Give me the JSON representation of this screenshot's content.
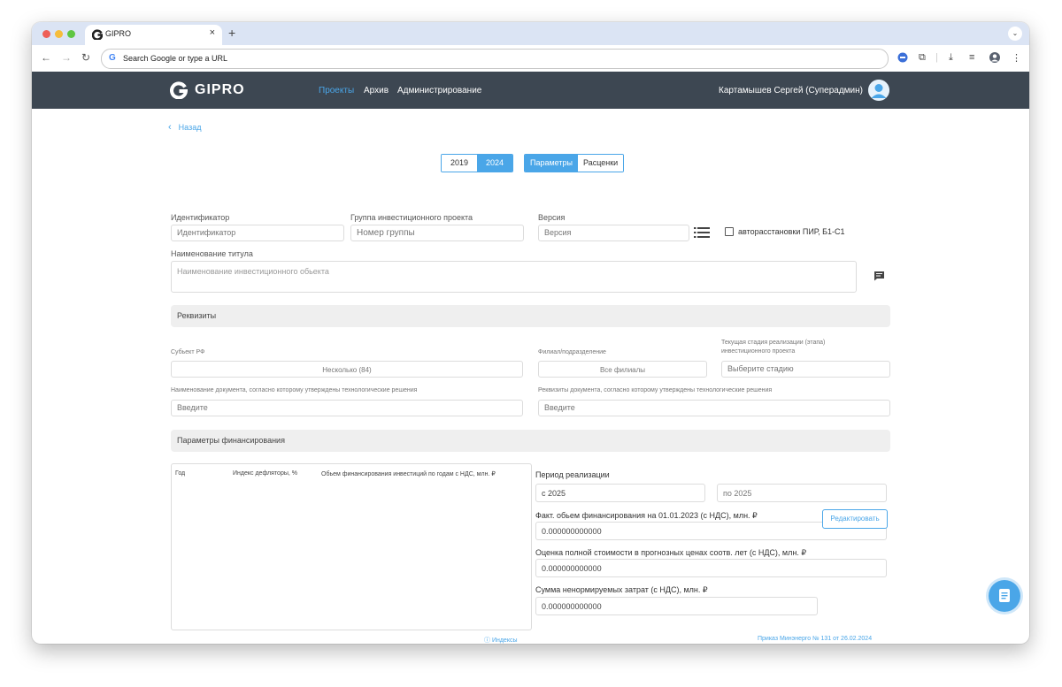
{
  "browser": {
    "tab_title": "GIPRO",
    "tab_close": "×",
    "new_tab": "+",
    "omnibox_text": "Search Google or type a URL",
    "g_letter": "G"
  },
  "app": {
    "brand": "GIPRO",
    "menu": [
      "Проекты",
      "Архив",
      "Администрирование"
    ],
    "user_name": "Картамышев Сергей (Суперадмин)"
  },
  "page": {
    "back_label": "Назад",
    "years": [
      "2019",
      "2024"
    ],
    "views": [
      "Параметры",
      "Расценки"
    ],
    "identifier": {
      "label": "Идентификатор",
      "placeholder": "Идентификатор"
    },
    "group": {
      "label": "Группа инвестиционного проекта",
      "placeholder": "Номер группы"
    },
    "version": {
      "label": "Версия",
      "placeholder": "Версия"
    },
    "auto_checkbox_label": "авторасстановки ПИР, Б1-С1",
    "title_name": {
      "label": "Наименование титула",
      "placeholder": "Наименование инвестиционного обьекта"
    },
    "section_requisites": "Реквизиты",
    "subject": {
      "label": "Субьект РФ",
      "value": "Несколько (84)"
    },
    "branch": {
      "label": "Филиал/подразделение",
      "value": "Все филиалы"
    },
    "stage": {
      "label_line1": "Текущая стадия реализации (этапа)",
      "label_line2": "инвестиционного проекта",
      "placeholder": "Выберите стадию"
    },
    "doc_name": {
      "label": "Наименование документа, согласно которому утверждены технологические решения",
      "placeholder": "Введите"
    },
    "doc_requisites": {
      "label": "Реквизиты документа, согласно которому утверждены технологические решения",
      "placeholder": "Введите"
    },
    "section_financing": "Параметры финансирования",
    "table_headers": [
      "Год",
      "Индекс дефляторы, %",
      "Обьем финансирования инвестиций по годам с НДС, млн. ₽"
    ],
    "period_label": "Период реализации",
    "period_from": "с  2025",
    "period_to": "по  2025",
    "fact_label": "Факт. обьем финансирования на 01.01.2023 (с НДС), млн. ₽",
    "fact_value": "0.000000000000",
    "estimate_label": "Оценка полной стоимости в прогнозных ценах соотв. лет (с НДС), млн. ₽",
    "estimate_value": "0.000000000000",
    "nonnorm_label": "Сумма ненормируемых затрат (с НДС), млн. ₽",
    "nonnorm_value": "0.000000000000",
    "edit_button": "Редактировать",
    "indexes_link": "ⓘ Индексы",
    "order_link": "Приказ Минэнерго № 131 от 26.02.2024"
  },
  "colors": {
    "accent": "#4aa6e8",
    "appbar": "#3d4752"
  }
}
